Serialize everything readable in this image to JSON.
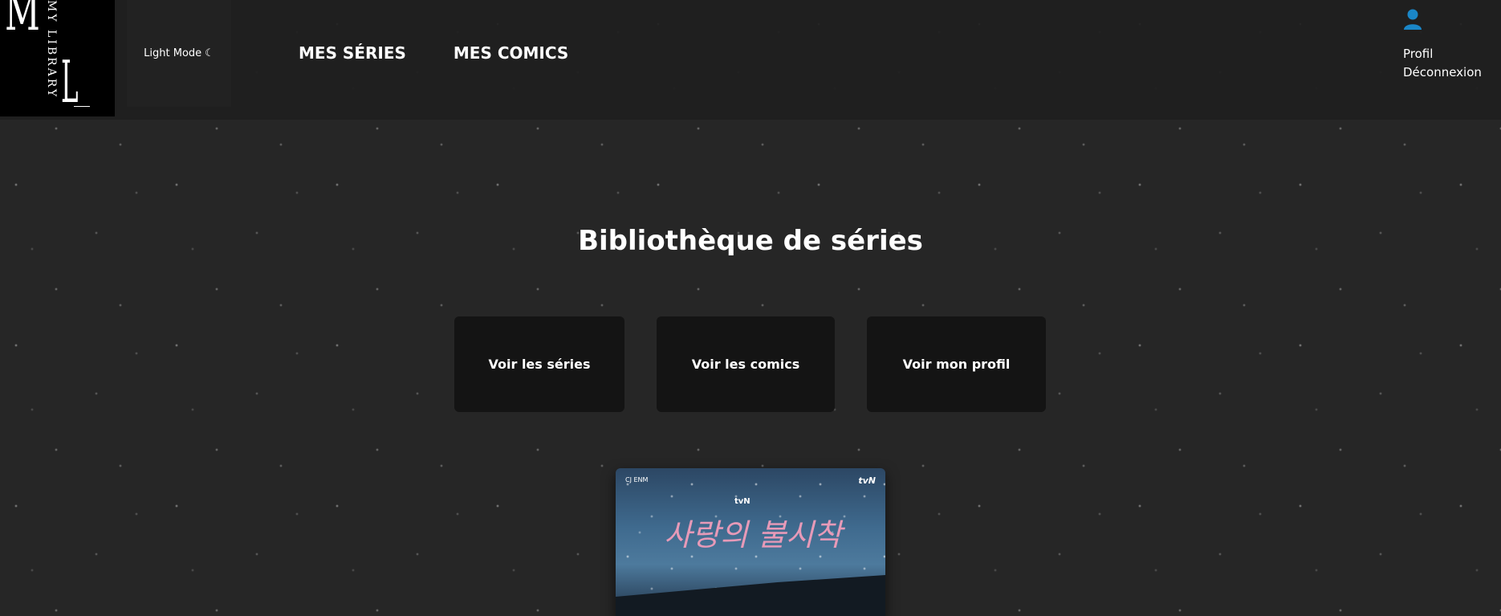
{
  "header": {
    "logo": {
      "letters_main": "M",
      "letters_second": "L",
      "vertical_text": "MY LIBRARY"
    },
    "mode_toggle": {
      "label": "Light Mode",
      "icon": "☾"
    },
    "nav": [
      {
        "label": "MES SÉRIES"
      },
      {
        "label": "MES COMICS"
      }
    ],
    "user": {
      "icon": "user-icon",
      "accent_color": "#1a86c7",
      "links": [
        {
          "label": "Profil"
        },
        {
          "label": "Déconnexion"
        }
      ]
    }
  },
  "main": {
    "title": "Bibliothèque de séries",
    "actions": [
      {
        "label": "Voir les séries"
      },
      {
        "label": "Voir les comics"
      },
      {
        "label": "Voir mon profil"
      }
    ],
    "poster": {
      "hangul_title": "사랑의 불시착",
      "sub_logo": "tvN",
      "corner_left": "CJ ENM",
      "corner_right": "tvN"
    }
  }
}
